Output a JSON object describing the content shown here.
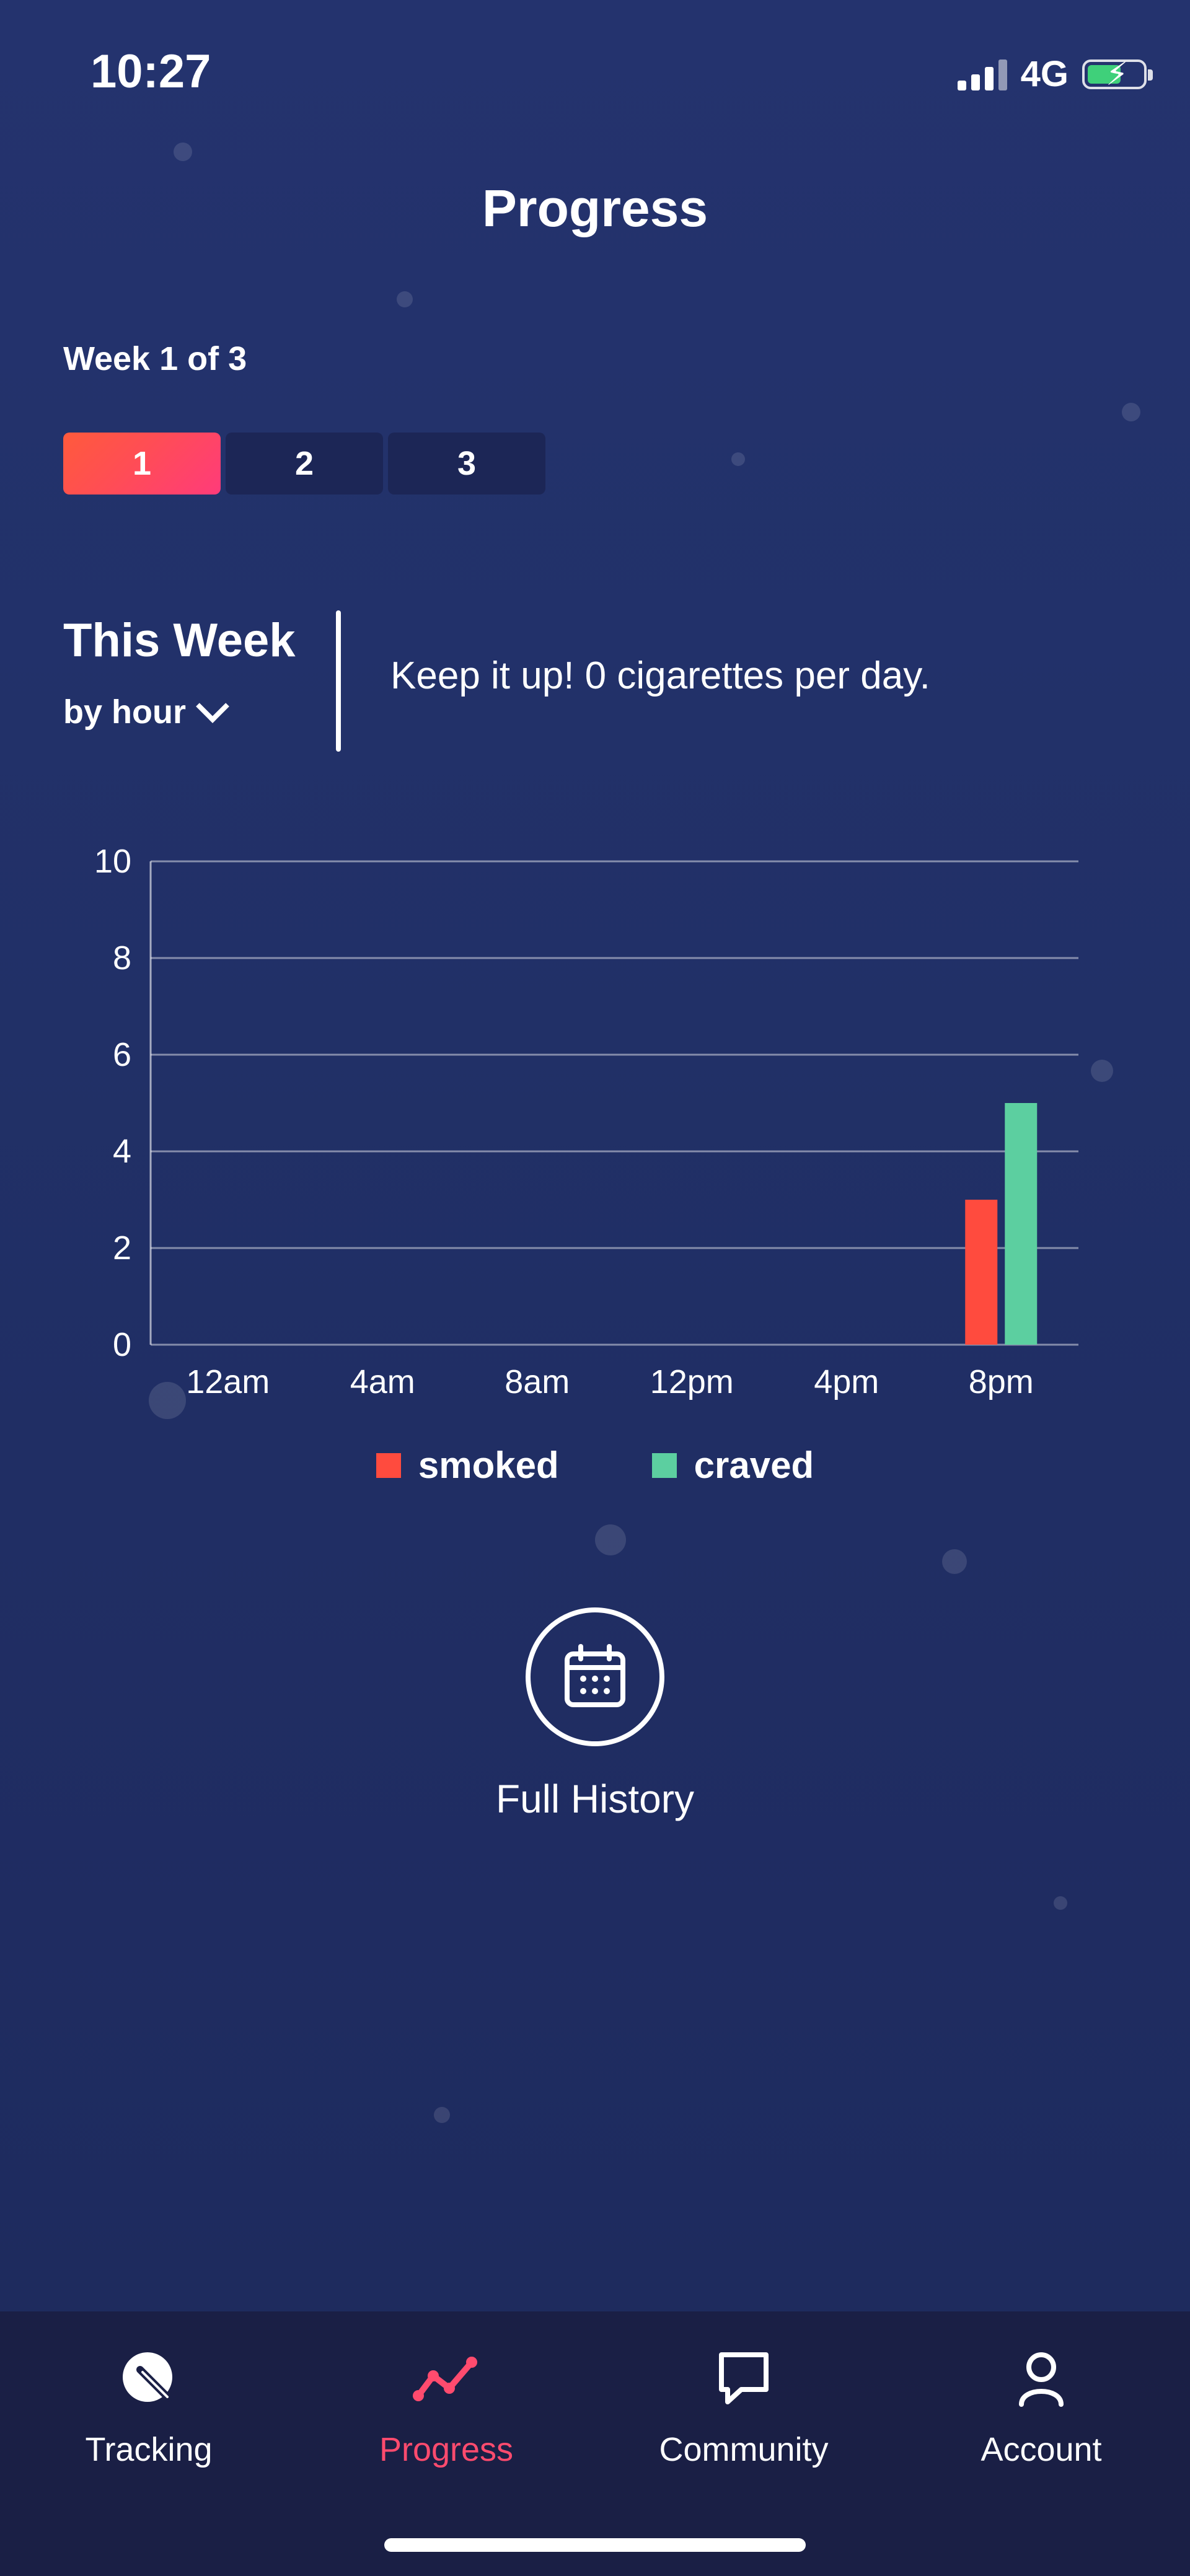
{
  "status_bar": {
    "time": "10:27",
    "network": "4G"
  },
  "header": {
    "title": "Progress"
  },
  "week": {
    "label": "Week 1 of 3",
    "tabs": [
      {
        "label": "1",
        "active": true
      },
      {
        "label": "2",
        "active": false
      },
      {
        "label": "3",
        "active": false
      }
    ]
  },
  "summary": {
    "title": "This Week",
    "filter": "by hour",
    "message": "Keep it up! 0 cigarettes per day."
  },
  "chart_data": {
    "type": "bar",
    "categories": [
      "12am",
      "4am",
      "8am",
      "12pm",
      "4pm",
      "8pm"
    ],
    "series": [
      {
        "name": "smoked",
        "color": "#ff4b3e",
        "values": [
          0,
          0,
          0,
          0,
          0,
          3
        ]
      },
      {
        "name": "craved",
        "color": "#5ccfa0",
        "values": [
          0,
          0,
          0,
          0,
          0,
          5
        ]
      }
    ],
    "yticks": [
      "0",
      "2",
      "4",
      "6",
      "8",
      "10"
    ],
    "ylim": [
      0,
      10
    ],
    "grid": true,
    "legend_position": "bottom"
  },
  "history": {
    "label": "Full History",
    "icon": "calendar-icon"
  },
  "tabbar": {
    "active_color": "#ff4b6e",
    "items": [
      {
        "label": "Tracking",
        "icon": "tracking-icon",
        "active": false
      },
      {
        "label": "Progress",
        "icon": "progress-icon",
        "active": true
      },
      {
        "label": "Community",
        "icon": "chat-bubble-icon",
        "active": false
      },
      {
        "label": "Account",
        "icon": "user-icon",
        "active": false
      }
    ]
  }
}
